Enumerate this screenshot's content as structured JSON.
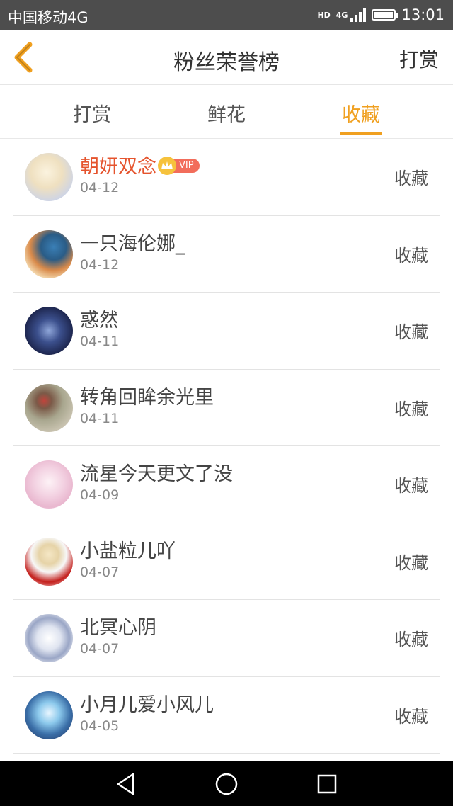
{
  "status_bar": {
    "carrier": "中国移动4G",
    "hd": "HD",
    "network": "4G",
    "time": "13:01",
    "battery_level": 0.86
  },
  "header": {
    "title": "粉丝荣誉榜",
    "right_action": "打赏"
  },
  "tabs": [
    {
      "label": "打赏",
      "active": false
    },
    {
      "label": "鲜花",
      "active": false
    },
    {
      "label": "收藏",
      "active": true
    }
  ],
  "colors": {
    "accent": "#f0a020",
    "highlight_name": "#e5542e",
    "vip_tag": "#f26d5b",
    "status_bar_bg": "#4d4d4d"
  },
  "vip_label": "VIP",
  "fans": [
    {
      "name": "朝妍双念",
      "date": "04-12",
      "type": "收藏",
      "vip": true
    },
    {
      "name": "一只海伦娜_",
      "date": "04-12",
      "type": "收藏"
    },
    {
      "name": "惑然",
      "date": "04-11",
      "type": "收藏"
    },
    {
      "name": "转角回眸余光里",
      "date": "04-11",
      "type": "收藏"
    },
    {
      "name": "流星今天更文了没",
      "date": "04-09",
      "type": "收藏"
    },
    {
      "name": "小盐粒儿吖",
      "date": "04-07",
      "type": "收藏"
    },
    {
      "name": "北冥心阴",
      "date": "04-07",
      "type": "收藏"
    },
    {
      "name": "小月儿爱小风儿",
      "date": "04-05",
      "type": "收藏"
    }
  ],
  "nav_bar": {
    "back_icon": "triangle-back-icon",
    "home_icon": "circle-home-icon",
    "recents_icon": "square-recents-icon"
  }
}
